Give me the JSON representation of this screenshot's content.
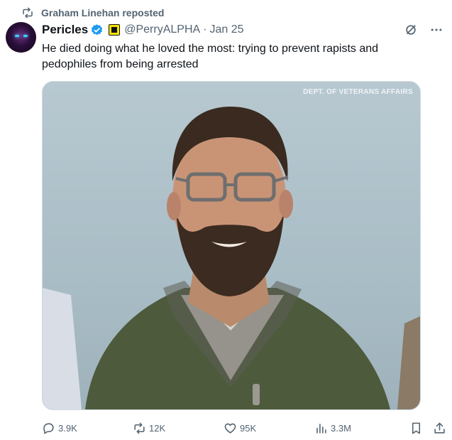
{
  "repost": {
    "text": "Graham Linehan reposted",
    "icon": "repost-icon"
  },
  "author": {
    "name": "Pericles",
    "handle": "@PerryALPHA",
    "separator": "·",
    "date": "Jan 25",
    "verified": true,
    "verified_color": "#1d9bf0"
  },
  "tweet": {
    "text": "He died doing what he loved the most: trying to prevent rapists and pedophiles from being arrested"
  },
  "media": {
    "watermark": "DEPT. OF VETERANS AFFAIRS"
  },
  "metrics": {
    "replies": "3.9K",
    "reposts": "12K",
    "likes": "95K",
    "views": "3.3M"
  }
}
